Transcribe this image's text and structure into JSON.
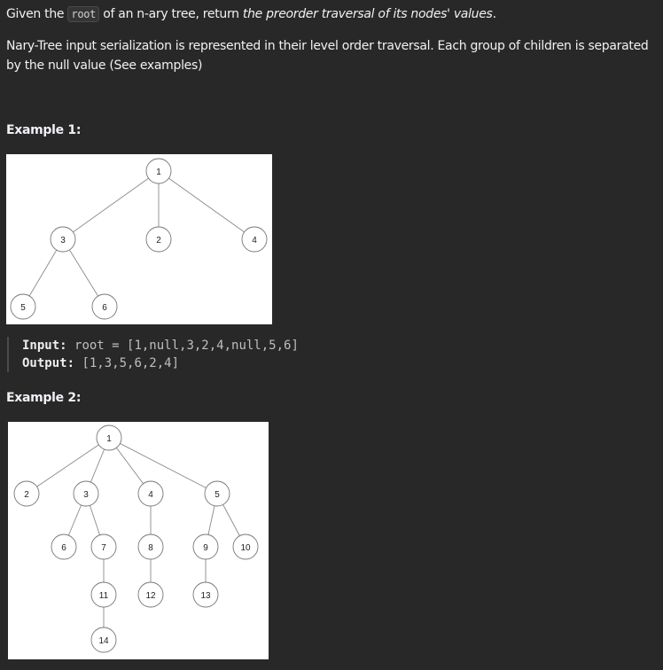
{
  "problem": {
    "intro_before": "Given the ",
    "intro_code": "root",
    "intro_middle": " of an n-ary tree, return ",
    "intro_em": "the preorder traversal of its nodes' values",
    "intro_after": ".",
    "serialization_note": "Nary-Tree input serialization is represented in their level order traversal. Each group of children is separated by the null value (See examples)"
  },
  "example1": {
    "heading": "Example 1:",
    "input_label": "Input:",
    "input_value": "root = [1,null,3,2,4,null,5,6]",
    "output_label": "Output:",
    "output_value": "[1,3,5,6,2,4]",
    "nodes": [
      "1",
      "3",
      "2",
      "4",
      "5",
      "6"
    ]
  },
  "example2": {
    "heading": "Example 2:",
    "nodes": [
      "1",
      "2",
      "3",
      "4",
      "5",
      "6",
      "7",
      "8",
      "9",
      "10",
      "11",
      "12",
      "13",
      "14"
    ]
  }
}
